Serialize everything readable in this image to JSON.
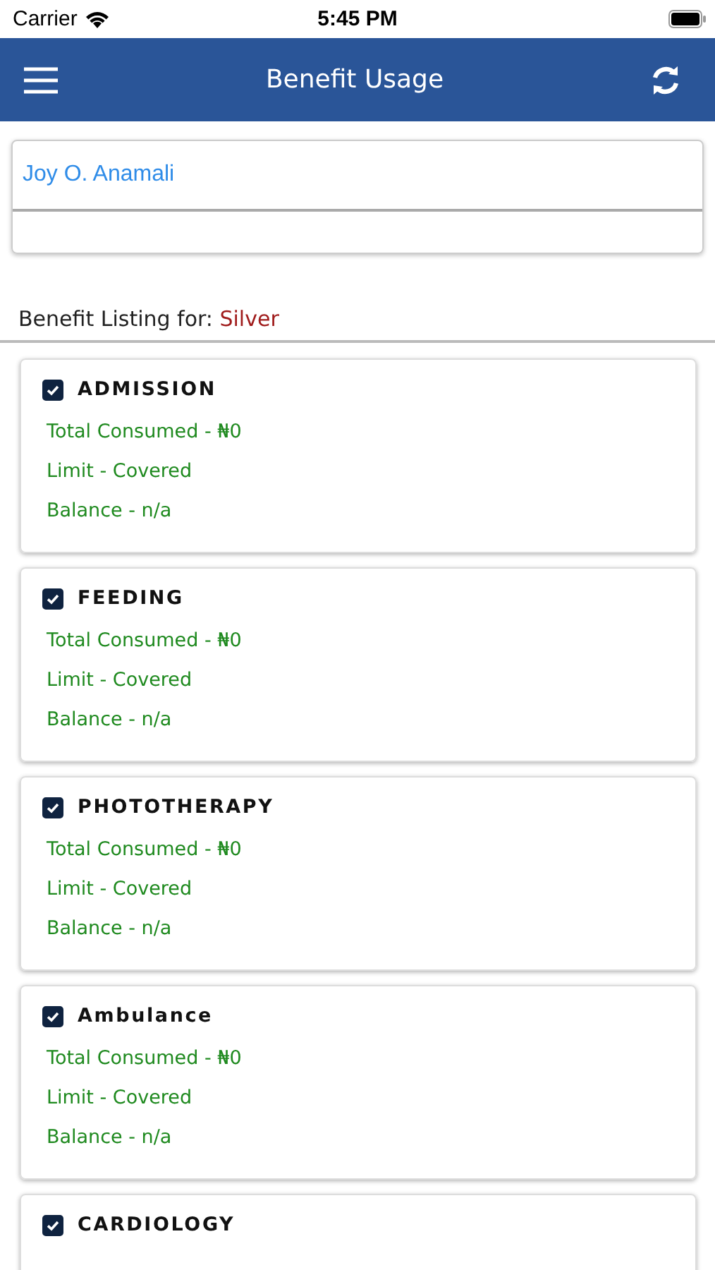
{
  "status_bar": {
    "carrier": "Carrier",
    "time": "5:45 PM"
  },
  "header": {
    "title": "Benefit Usage"
  },
  "member": {
    "name": "Joy O. Anamali"
  },
  "listing": {
    "label": "Benefit Listing for:",
    "plan": "Silver"
  },
  "benefits": [
    {
      "name": "ADMISSION",
      "checked": true,
      "lines": [
        "Total Consumed - ₦0",
        "Limit - Covered",
        "Balance - n/a"
      ]
    },
    {
      "name": "FEEDING",
      "checked": true,
      "lines": [
        "Total Consumed - ₦0",
        "Limit - Covered",
        "Balance - n/a"
      ]
    },
    {
      "name": "PHOTOTHERAPY",
      "checked": true,
      "lines": [
        "Total Consumed - ₦0",
        "Limit - Covered",
        "Balance - n/a"
      ]
    },
    {
      "name": "Ambulance",
      "checked": true,
      "lines": [
        "Total Consumed - ₦0",
        "Limit - Covered",
        "Balance - n/a"
      ]
    },
    {
      "name": "CARDIOLOGY",
      "checked": true
    }
  ]
}
